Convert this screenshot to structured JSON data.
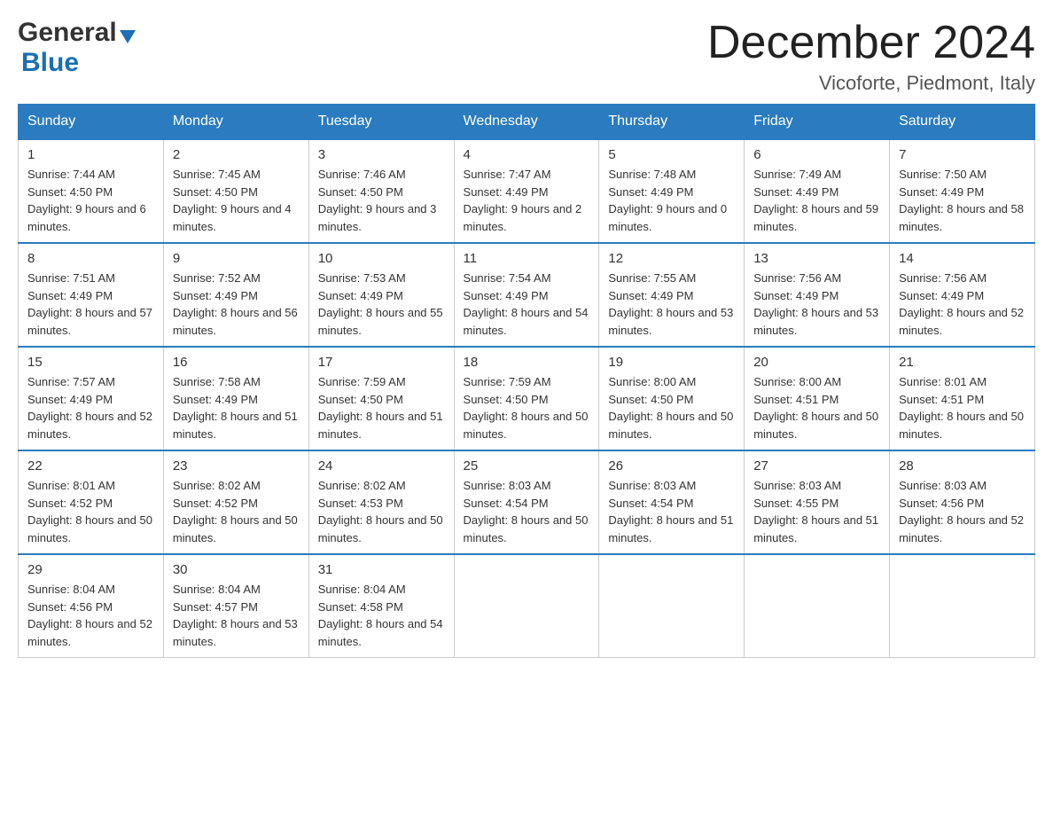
{
  "header": {
    "month": "December 2024",
    "location": "Vicoforte, Piedmont, Italy",
    "logo_general": "General",
    "logo_blue": "Blue"
  },
  "days_of_week": [
    "Sunday",
    "Monday",
    "Tuesday",
    "Wednesday",
    "Thursday",
    "Friday",
    "Saturday"
  ],
  "weeks": [
    [
      {
        "day": "1",
        "sunrise": "7:44 AM",
        "sunset": "4:50 PM",
        "daylight": "9 hours and 6 minutes."
      },
      {
        "day": "2",
        "sunrise": "7:45 AM",
        "sunset": "4:50 PM",
        "daylight": "9 hours and 4 minutes."
      },
      {
        "day": "3",
        "sunrise": "7:46 AM",
        "sunset": "4:50 PM",
        "daylight": "9 hours and 3 minutes."
      },
      {
        "day": "4",
        "sunrise": "7:47 AM",
        "sunset": "4:49 PM",
        "daylight": "9 hours and 2 minutes."
      },
      {
        "day": "5",
        "sunrise": "7:48 AM",
        "sunset": "4:49 PM",
        "daylight": "9 hours and 0 minutes."
      },
      {
        "day": "6",
        "sunrise": "7:49 AM",
        "sunset": "4:49 PM",
        "daylight": "8 hours and 59 minutes."
      },
      {
        "day": "7",
        "sunrise": "7:50 AM",
        "sunset": "4:49 PM",
        "daylight": "8 hours and 58 minutes."
      }
    ],
    [
      {
        "day": "8",
        "sunrise": "7:51 AM",
        "sunset": "4:49 PM",
        "daylight": "8 hours and 57 minutes."
      },
      {
        "day": "9",
        "sunrise": "7:52 AM",
        "sunset": "4:49 PM",
        "daylight": "8 hours and 56 minutes."
      },
      {
        "day": "10",
        "sunrise": "7:53 AM",
        "sunset": "4:49 PM",
        "daylight": "8 hours and 55 minutes."
      },
      {
        "day": "11",
        "sunrise": "7:54 AM",
        "sunset": "4:49 PM",
        "daylight": "8 hours and 54 minutes."
      },
      {
        "day": "12",
        "sunrise": "7:55 AM",
        "sunset": "4:49 PM",
        "daylight": "8 hours and 53 minutes."
      },
      {
        "day": "13",
        "sunrise": "7:56 AM",
        "sunset": "4:49 PM",
        "daylight": "8 hours and 53 minutes."
      },
      {
        "day": "14",
        "sunrise": "7:56 AM",
        "sunset": "4:49 PM",
        "daylight": "8 hours and 52 minutes."
      }
    ],
    [
      {
        "day": "15",
        "sunrise": "7:57 AM",
        "sunset": "4:49 PM",
        "daylight": "8 hours and 52 minutes."
      },
      {
        "day": "16",
        "sunrise": "7:58 AM",
        "sunset": "4:49 PM",
        "daylight": "8 hours and 51 minutes."
      },
      {
        "day": "17",
        "sunrise": "7:59 AM",
        "sunset": "4:50 PM",
        "daylight": "8 hours and 51 minutes."
      },
      {
        "day": "18",
        "sunrise": "7:59 AM",
        "sunset": "4:50 PM",
        "daylight": "8 hours and 50 minutes."
      },
      {
        "day": "19",
        "sunrise": "8:00 AM",
        "sunset": "4:50 PM",
        "daylight": "8 hours and 50 minutes."
      },
      {
        "day": "20",
        "sunrise": "8:00 AM",
        "sunset": "4:51 PM",
        "daylight": "8 hours and 50 minutes."
      },
      {
        "day": "21",
        "sunrise": "8:01 AM",
        "sunset": "4:51 PM",
        "daylight": "8 hours and 50 minutes."
      }
    ],
    [
      {
        "day": "22",
        "sunrise": "8:01 AM",
        "sunset": "4:52 PM",
        "daylight": "8 hours and 50 minutes."
      },
      {
        "day": "23",
        "sunrise": "8:02 AM",
        "sunset": "4:52 PM",
        "daylight": "8 hours and 50 minutes."
      },
      {
        "day": "24",
        "sunrise": "8:02 AM",
        "sunset": "4:53 PM",
        "daylight": "8 hours and 50 minutes."
      },
      {
        "day": "25",
        "sunrise": "8:03 AM",
        "sunset": "4:54 PM",
        "daylight": "8 hours and 50 minutes."
      },
      {
        "day": "26",
        "sunrise": "8:03 AM",
        "sunset": "4:54 PM",
        "daylight": "8 hours and 51 minutes."
      },
      {
        "day": "27",
        "sunrise": "8:03 AM",
        "sunset": "4:55 PM",
        "daylight": "8 hours and 51 minutes."
      },
      {
        "day": "28",
        "sunrise": "8:03 AM",
        "sunset": "4:56 PM",
        "daylight": "8 hours and 52 minutes."
      }
    ],
    [
      {
        "day": "29",
        "sunrise": "8:04 AM",
        "sunset": "4:56 PM",
        "daylight": "8 hours and 52 minutes."
      },
      {
        "day": "30",
        "sunrise": "8:04 AM",
        "sunset": "4:57 PM",
        "daylight": "8 hours and 53 minutes."
      },
      {
        "day": "31",
        "sunrise": "8:04 AM",
        "sunset": "4:58 PM",
        "daylight": "8 hours and 54 minutes."
      },
      null,
      null,
      null,
      null
    ]
  ]
}
